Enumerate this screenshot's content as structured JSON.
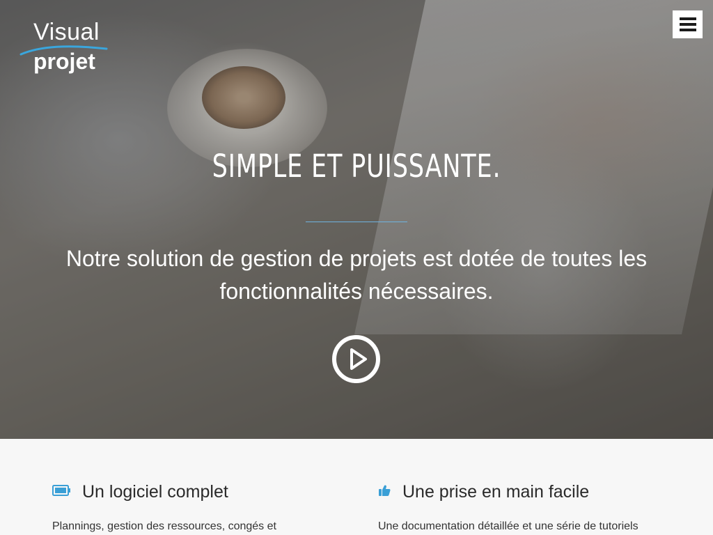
{
  "logo": {
    "line1": "Visual",
    "line2": "projet"
  },
  "header": {
    "menu_icon": "hamburger-menu-icon"
  },
  "hero": {
    "title": "SIMPLE ET PUISSANTE.",
    "subtitle": "Notre solution de gestion de projets est dotée de toutes les fonctionnalités nécessaires.",
    "play_icon": "play-circle-icon",
    "accent_color": "#6fb3e0"
  },
  "features": [
    {
      "icon": "battery-icon",
      "title": "Un logiciel complet",
      "text": "Plannings, gestion des ressources, congés et"
    },
    {
      "icon": "thumbs-up-icon",
      "title": "Une prise en main facile",
      "text": "Une documentation détaillée et une série de tutoriels"
    }
  ],
  "colors": {
    "icon_blue": "#3a9fd6",
    "logo_blue": "#3aa6dd"
  }
}
